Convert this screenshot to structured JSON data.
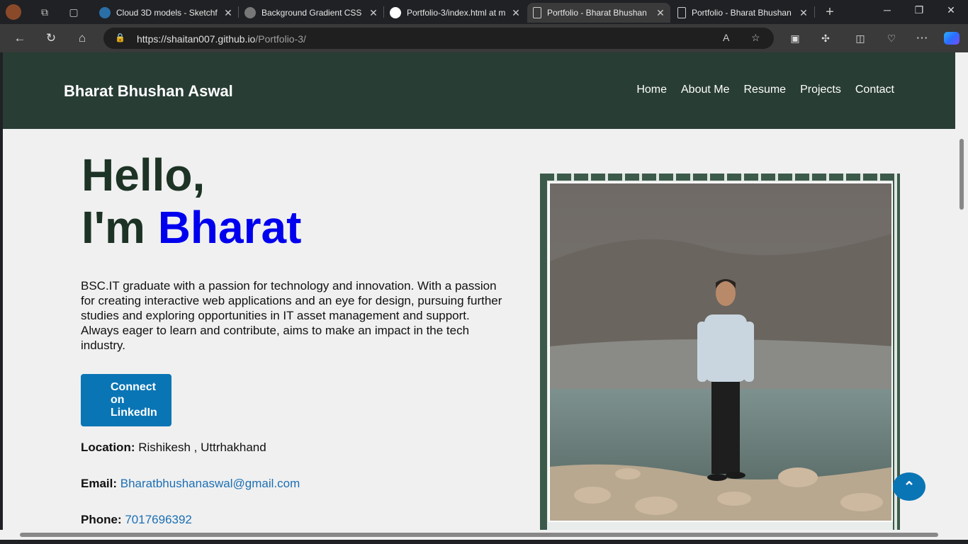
{
  "browser": {
    "tabs": [
      {
        "title": "Cloud 3D models - Sketchf",
        "color": "#2a6fa8"
      },
      {
        "title": "Background Gradient CSS",
        "color": "#777777"
      },
      {
        "title": "Portfolio-3/index.html at m",
        "color": "#ffffff"
      },
      {
        "title": "Portfolio - Bharat Bhushan",
        "color": "#cccccc"
      },
      {
        "title": "Portfolio - Bharat Bhushan",
        "color": "#cccccc"
      }
    ],
    "url_host": "https://shaitan007.github.io",
    "url_path": "/Portfolio-3/"
  },
  "nav": {
    "brand": "Bharat Bhushan Aswal",
    "items": [
      "Home",
      "About Me",
      "Resume",
      "Projects",
      "Contact"
    ]
  },
  "hero": {
    "line1": "Hello,",
    "line2_prefix": "I'm ",
    "name": "Bharat",
    "bio": "BSC.IT graduate with a passion for technology and innovation. With a passion for creating interactive web applications and an eye for design, pursuing further studies and exploring opportunities in IT asset management and support. Always eager to learn and contribute, aims to make an impact in the tech industry.",
    "cta": "Connect on LinkedIn"
  },
  "contact": {
    "location_label": "Location:",
    "location_value": "Rishikesh , Uttrhakhand",
    "email_label": "Email:",
    "email_value": "Bharatbhushanaswal@gmail.com",
    "phone_label": "Phone:",
    "phone_value": "7017696392"
  },
  "colors": {
    "nav_bg": "#283d34",
    "accent": "#0000ee",
    "button": "#0a75b5"
  }
}
